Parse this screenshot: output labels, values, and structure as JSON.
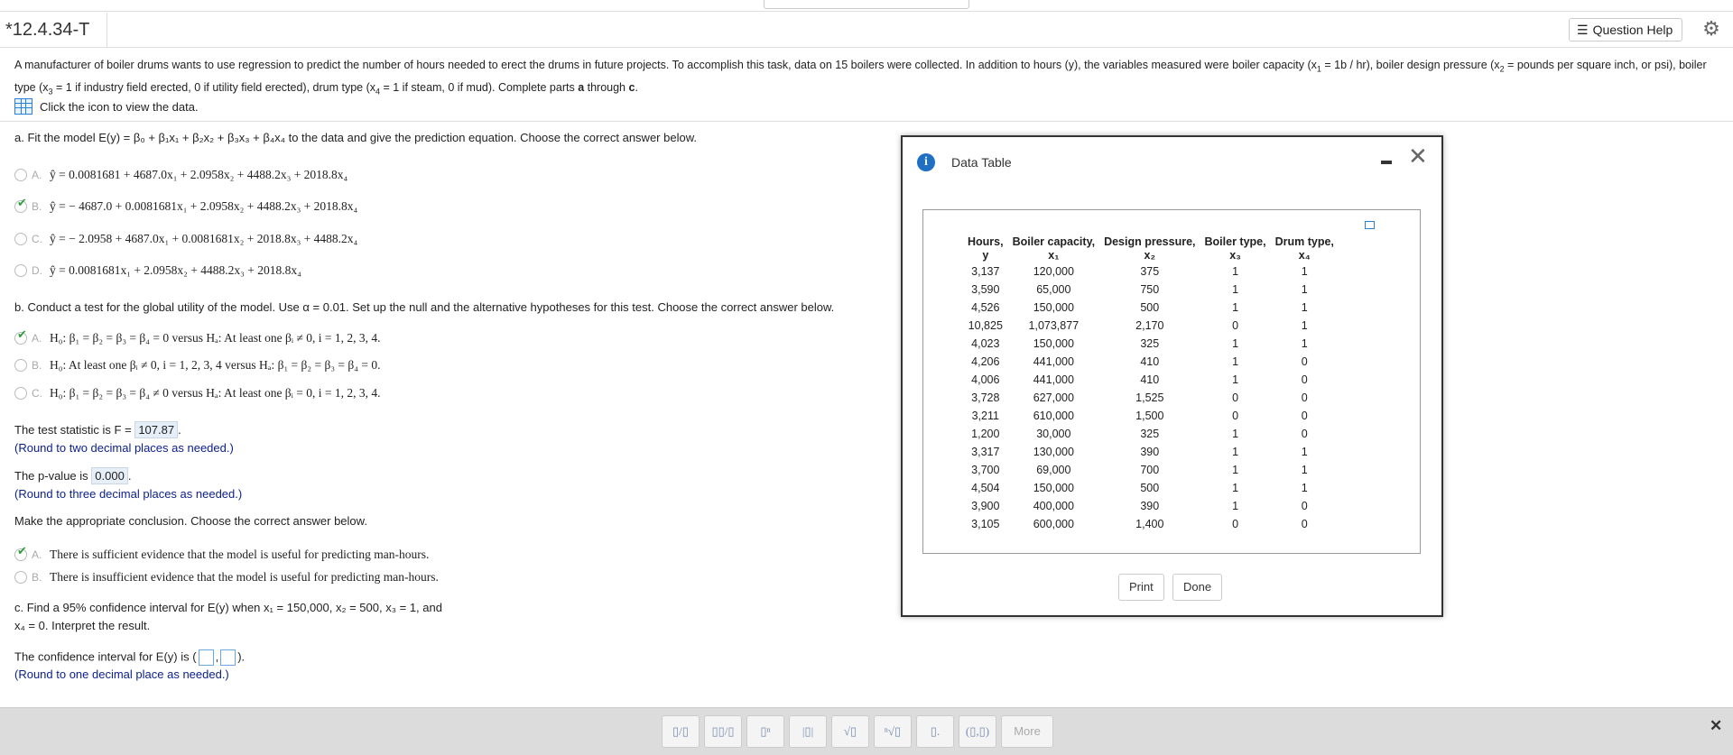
{
  "header": {
    "question_id": "*12.4.34-T",
    "help_label": "Question Help"
  },
  "intro": {
    "text_html": "A manufacturer of boiler drums wants to use regression to predict the number of hours needed to erect the drums in future projects. To accomplish this task, data on 15 boilers were collected. In addition to hours (y), the variables measured were boiler capacity (x<sub>1</sub> = 1b / hr), boiler design pressure (x<sub>2</sub> = pounds per square inch, or psi), boiler type (x<sub>3</sub> = 1 if industry field erected, 0 if utility field erected), drum type (x<sub>4</sub> = 1 if steam, 0 if mud). Complete parts <b>a</b> through <b>c</b>.",
    "click_text": "Click the icon to view the data."
  },
  "part_a": {
    "prompt": "a. Fit the model E(y) = β₀ + β₁x₁ + β₂x₂ + β₃x₃ + β₄x₄ to the data and give the prediction equation. Choose the correct answer below.",
    "options": [
      {
        "letter": "A.",
        "text": "ŷ = 0.0081681 + 4687.0x₁ + 2.0958x₂ + 4488.2x₃ + 2018.8x₄",
        "checked": false
      },
      {
        "letter": "B.",
        "text": "ŷ = − 4687.0 + 0.0081681x₁ + 2.0958x₂ + 4488.2x₃ + 2018.8x₄",
        "checked": true
      },
      {
        "letter": "C.",
        "text": "ŷ = − 2.0958 + 4687.0x₁ + 0.0081681x₂ + 2018.8x₃ + 4488.2x₄",
        "checked": false
      },
      {
        "letter": "D.",
        "text": "ŷ = 0.0081681x₁ + 2.0958x₂ + 4488.2x₃ + 2018.8x₄",
        "checked": false
      }
    ]
  },
  "part_b": {
    "prompt": "b. Conduct a test for the global utility of the model. Use α = 0.01. Set up the null and the alternative hypotheses for this test. Choose the correct answer below.",
    "options": [
      {
        "letter": "A.",
        "text": "H₀: β₁ = β₂ = β₃ = β₄ = 0 versus Hₐ: At least one βᵢ ≠ 0, i = 1, 2, 3, 4.",
        "checked": true
      },
      {
        "letter": "B.",
        "text": "H₀: At least one βᵢ ≠ 0, i = 1, 2, 3, 4 versus Hₐ: β₁ = β₂ = β₃ = β₄ = 0.",
        "checked": false
      },
      {
        "letter": "C.",
        "text": "H₀: β₁ = β₂ = β₃ = β₄ ≠ 0 versus Hₐ: At least one βᵢ = 0, i = 1, 2, 3, 4.",
        "checked": false
      }
    ],
    "stat_label": "The test statistic is F =",
    "stat_value": "107.87",
    "stat_round": "(Round to two decimal places as needed.)",
    "p_label": "The p-value is",
    "p_value": "0.000",
    "p_round": "(Round to three decimal places as needed.)",
    "conclusion_prompt": "Make the appropriate conclusion. Choose the correct answer below.",
    "conclusion_options": [
      {
        "letter": "A.",
        "text": "There is sufficient evidence that the model is useful for predicting man-hours.",
        "checked": true
      },
      {
        "letter": "B.",
        "text": "There is insufficient evidence that the model is useful for predicting man-hours.",
        "checked": false
      }
    ]
  },
  "part_c": {
    "prompt_line1": "c. Find a 95% confidence interval for E(y) when x₁ = 150,000, x₂ = 500, x₃ = 1, and",
    "prompt_line2": "x₄ = 0. Interpret the result.",
    "ci_label": "The confidence interval for E(y) is (",
    "ci_round": "(Round to one decimal place as needed.)"
  },
  "dialog": {
    "title": "Data Table",
    "headers": [
      {
        "top": "Hours,",
        "bottom": "y"
      },
      {
        "top": "Boiler capacity,",
        "bottom": "x₁"
      },
      {
        "top": "Design pressure,",
        "bottom": "x₂"
      },
      {
        "top": "Boiler type,",
        "bottom": "x₃"
      },
      {
        "top": "Drum type,",
        "bottom": "x₄"
      }
    ],
    "rows": [
      [
        "3,137",
        "120,000",
        "375",
        "1",
        "1"
      ],
      [
        "3,590",
        "65,000",
        "750",
        "1",
        "1"
      ],
      [
        "4,526",
        "150,000",
        "500",
        "1",
        "1"
      ],
      [
        "10,825",
        "1,073,877",
        "2,170",
        "0",
        "1"
      ],
      [
        "4,023",
        "150,000",
        "325",
        "1",
        "1"
      ],
      [
        "4,206",
        "441,000",
        "410",
        "1",
        "0"
      ],
      [
        "4,006",
        "441,000",
        "410",
        "1",
        "0"
      ],
      [
        "3,728",
        "627,000",
        "1,525",
        "0",
        "0"
      ],
      [
        "3,211",
        "610,000",
        "1,500",
        "0",
        "0"
      ],
      [
        "1,200",
        "30,000",
        "325",
        "1",
        "0"
      ],
      [
        "3,317",
        "130,000",
        "390",
        "1",
        "1"
      ],
      [
        "3,700",
        "69,000",
        "700",
        "1",
        "1"
      ],
      [
        "4,504",
        "150,000",
        "500",
        "1",
        "1"
      ],
      [
        "3,900",
        "400,000",
        "390",
        "1",
        "0"
      ],
      [
        "3,105",
        "600,000",
        "1,400",
        "0",
        "0"
      ]
    ],
    "print_label": "Print",
    "done_label": "Done"
  },
  "toolbar": {
    "buttons": [
      "▯/▯",
      "▯▯/▯",
      "▯ⁿ",
      "|▯|",
      "√▯",
      "ⁿ√▯",
      "▯.",
      "(▯,▯)"
    ],
    "more_label": "More",
    "close_glyph": "✕"
  }
}
